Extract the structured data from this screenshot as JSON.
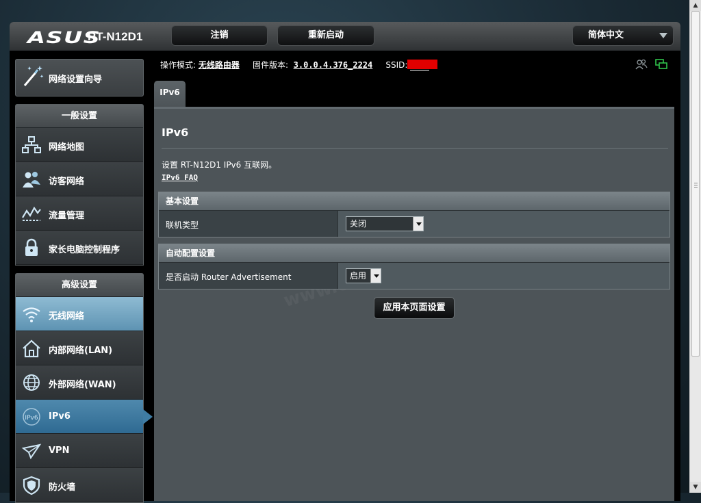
{
  "brand": {
    "logo": "ASUS",
    "model": "RT-N12D1"
  },
  "top_buttons": {
    "logout": "注销",
    "reboot": "重新启动",
    "language": "简体中文"
  },
  "status": {
    "mode_label": "操作模式:",
    "mode_value": "无线路由器",
    "firmware_label": "固件版本:",
    "firmware_value": "3.0.0.4.376_2224",
    "ssid_label": "SSID:"
  },
  "sidebar": {
    "wizard": "网络设置向导",
    "general_title": "一般设置",
    "general_items": [
      {
        "label": "网络地图",
        "icon": "network-map-icon"
      },
      {
        "label": "访客网络",
        "icon": "guest-network-icon"
      },
      {
        "label": "流量管理",
        "icon": "traffic-manager-icon"
      },
      {
        "label": "家长电脑控制程序",
        "icon": "parental-control-lock-icon"
      }
    ],
    "advanced_title": "高级设置",
    "advanced_items": [
      {
        "label": "无线网络",
        "icon": "wireless-icon"
      },
      {
        "label": "内部网络(LAN)",
        "icon": "lan-home-icon"
      },
      {
        "label": "外部网络(WAN)",
        "icon": "wan-globe-icon"
      },
      {
        "label": "IPv6",
        "icon": "ipv6-icon"
      },
      {
        "label": "VPN",
        "icon": "vpn-icon"
      },
      {
        "label": "防火墙",
        "icon": "firewall-shield-icon"
      }
    ]
  },
  "tab": "IPv6",
  "main": {
    "title": "IPv6",
    "description": "设置 RT-N12D1 IPv6 互联网。",
    "faq_link": "IPv6 FAQ",
    "basic_section": {
      "header": "基本设置",
      "connection_type_label": "联机类型",
      "connection_type_value": "关闭"
    },
    "auto_section": {
      "header": "自动配置设置",
      "router_adv_label": "是否启动 Router Advertisement",
      "router_adv_value": "启用"
    },
    "apply_button": "应用本页面设置"
  },
  "colors": {
    "accent": "#3f7ca3",
    "highlight": "#8fbbd3",
    "ssid_mask": "#e10000"
  }
}
